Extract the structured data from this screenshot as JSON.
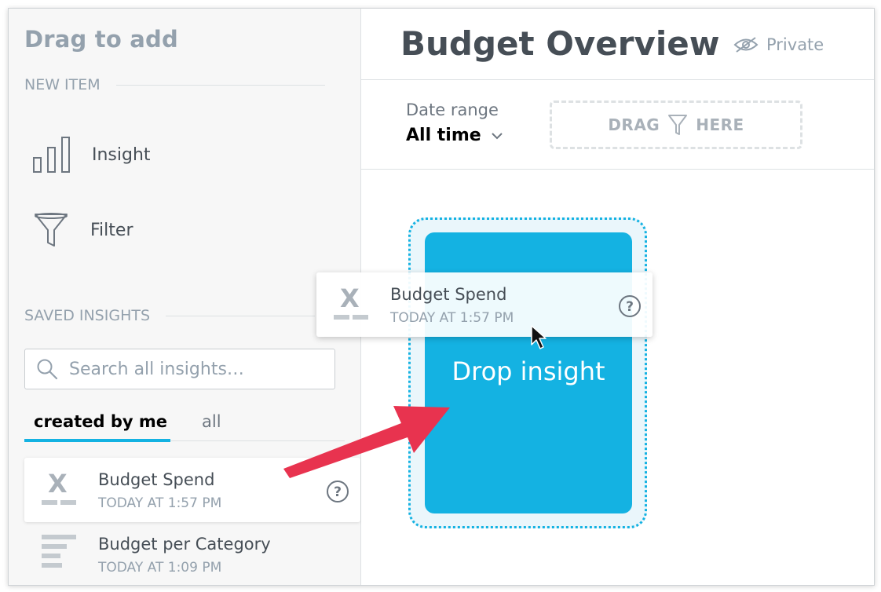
{
  "sidebar": {
    "title": "Drag to add",
    "new_item_heading": "NEW ITEM",
    "new_items": [
      {
        "label": "Insight",
        "icon": "bar-chart-icon"
      },
      {
        "label": "Filter",
        "icon": "funnel-icon"
      }
    ],
    "saved_heading": "SAVED INSIGHTS",
    "search_placeholder": "Search all insights…",
    "tabs": [
      {
        "label": "created by me",
        "active": true
      },
      {
        "label": "all",
        "active": false
      }
    ],
    "insights": [
      {
        "name": "Budget Spend",
        "date": "TODAY AT 1:57 PM",
        "icon": "headline-x-icon"
      },
      {
        "name": "Budget per Category",
        "date": "TODAY AT 1:09 PM",
        "icon": "horizontal-bar-icon"
      }
    ]
  },
  "dashboard": {
    "title": "Budget Overview",
    "visibility": "Private",
    "date_filter_label": "Date range",
    "date_filter_value": "All time",
    "filter_drop_before": "DRAG",
    "filter_drop_after": "HERE",
    "drop_zone_text": "Drop insight"
  },
  "dragging": {
    "name": "Budget Spend",
    "date": "TODAY AT 1:57 PM"
  },
  "colors": {
    "accent": "#14b2e2",
    "arrow": "#e8334f",
    "muted": "#94a1ad"
  }
}
